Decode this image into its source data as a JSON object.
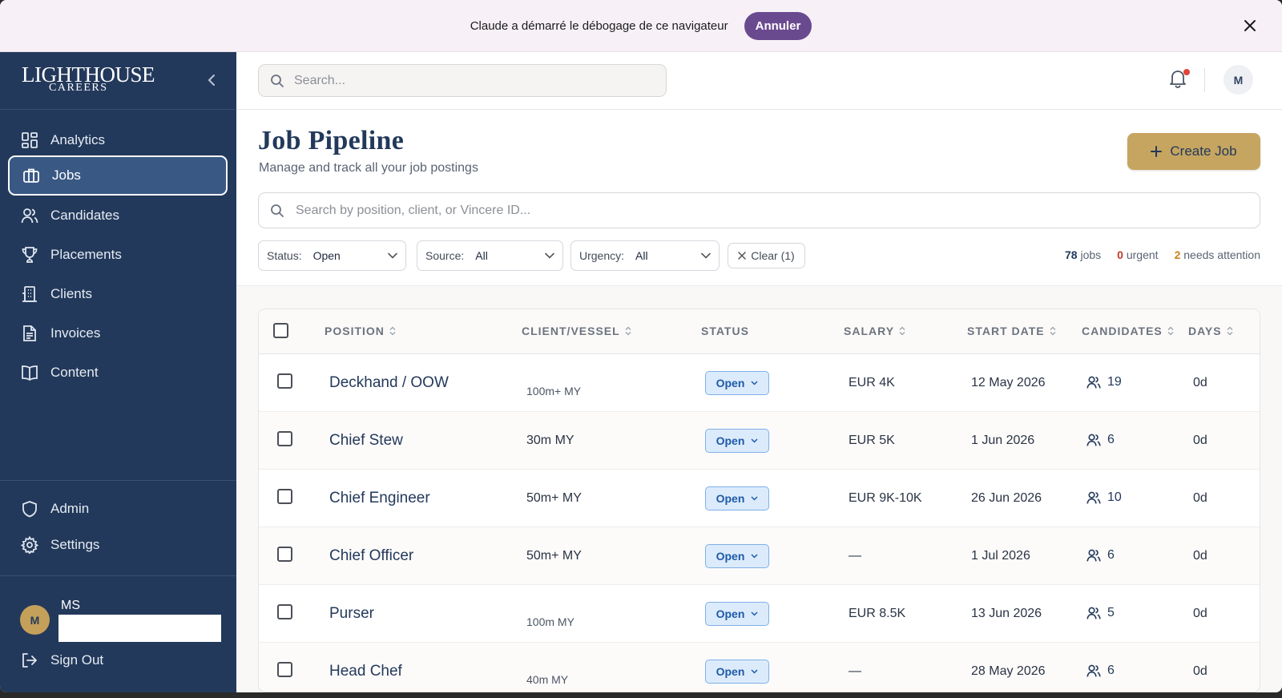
{
  "banner": {
    "text": "Claude a démarré le débogage de ce navigateur",
    "cancel_label": "Annuler"
  },
  "sidebar": {
    "logo": {
      "main": "LIGHTHOUSE",
      "sub": "CAREERS"
    },
    "items": [
      {
        "label": "Analytics",
        "icon": "analytics-grid-icon"
      },
      {
        "label": "Jobs",
        "icon": "briefcase-icon",
        "active": true
      },
      {
        "label": "Candidates",
        "icon": "users-icon"
      },
      {
        "label": "Placements",
        "icon": "trophy-icon"
      },
      {
        "label": "Clients",
        "icon": "building-icon"
      },
      {
        "label": "Invoices",
        "icon": "document-icon"
      },
      {
        "label": "Content",
        "icon": "book-icon"
      }
    ],
    "bottom_items": [
      {
        "label": "Admin",
        "icon": "shield-icon"
      },
      {
        "label": "Settings",
        "icon": "gear-icon"
      }
    ],
    "user": {
      "initial": "M",
      "name": "MS"
    },
    "sign_out_label": "Sign Out"
  },
  "topbar": {
    "search_placeholder": "Search...",
    "avatar_initial": "M"
  },
  "page": {
    "title": "Job Pipeline",
    "subtitle": "Manage and track all your job postings",
    "create_label": "Create Job",
    "search_placeholder": "Search by position, client, or Vincere ID..."
  },
  "filters": {
    "status": {
      "label": "Status:",
      "value": "Open"
    },
    "source": {
      "label": "Source:",
      "value": "All"
    },
    "urgency": {
      "label": "Urgency:",
      "value": "All"
    },
    "clear_label": "Clear (1)"
  },
  "stats": {
    "jobs_count": "78",
    "jobs_label": "jobs",
    "urgent_count": "0",
    "urgent_label": "urgent",
    "attention_count": "2",
    "attention_label": "needs attention"
  },
  "table": {
    "columns": [
      "POSITION",
      "CLIENT/VESSEL",
      "STATUS",
      "SALARY",
      "START DATE",
      "CANDIDATES",
      "DAYS"
    ],
    "rows": [
      {
        "position": "Deckhand / OOW",
        "client": "100m+ MY",
        "status": "Open",
        "salary": "EUR 4K",
        "start": "12 May 2026",
        "candidates": "19",
        "days": "0d"
      },
      {
        "position": "Chief Stew",
        "client": "30m MY",
        "status": "Open",
        "salary": "EUR 5K",
        "start": "1 Jun 2026",
        "candidates": "6",
        "days": "0d"
      },
      {
        "position": "Chief Engineer",
        "client": "50m+ MY",
        "status": "Open",
        "salary": "EUR 9K-10K",
        "start": "26 Jun 2026",
        "candidates": "10",
        "days": "0d"
      },
      {
        "position": "Chief Officer",
        "client": "50m+ MY",
        "status": "Open",
        "salary": "—",
        "start": "1 Jul 2026",
        "candidates": "6",
        "days": "0d"
      },
      {
        "position": "Purser",
        "client": "100m MY",
        "status": "Open",
        "salary": "EUR 8.5K",
        "start": "13 Jun 2026",
        "candidates": "5",
        "days": "0d"
      },
      {
        "position": "Head Chef",
        "client": "40m MY",
        "status": "Open",
        "salary": "—",
        "start": "28 May 2026",
        "candidates": "6",
        "days": "0d"
      }
    ]
  }
}
